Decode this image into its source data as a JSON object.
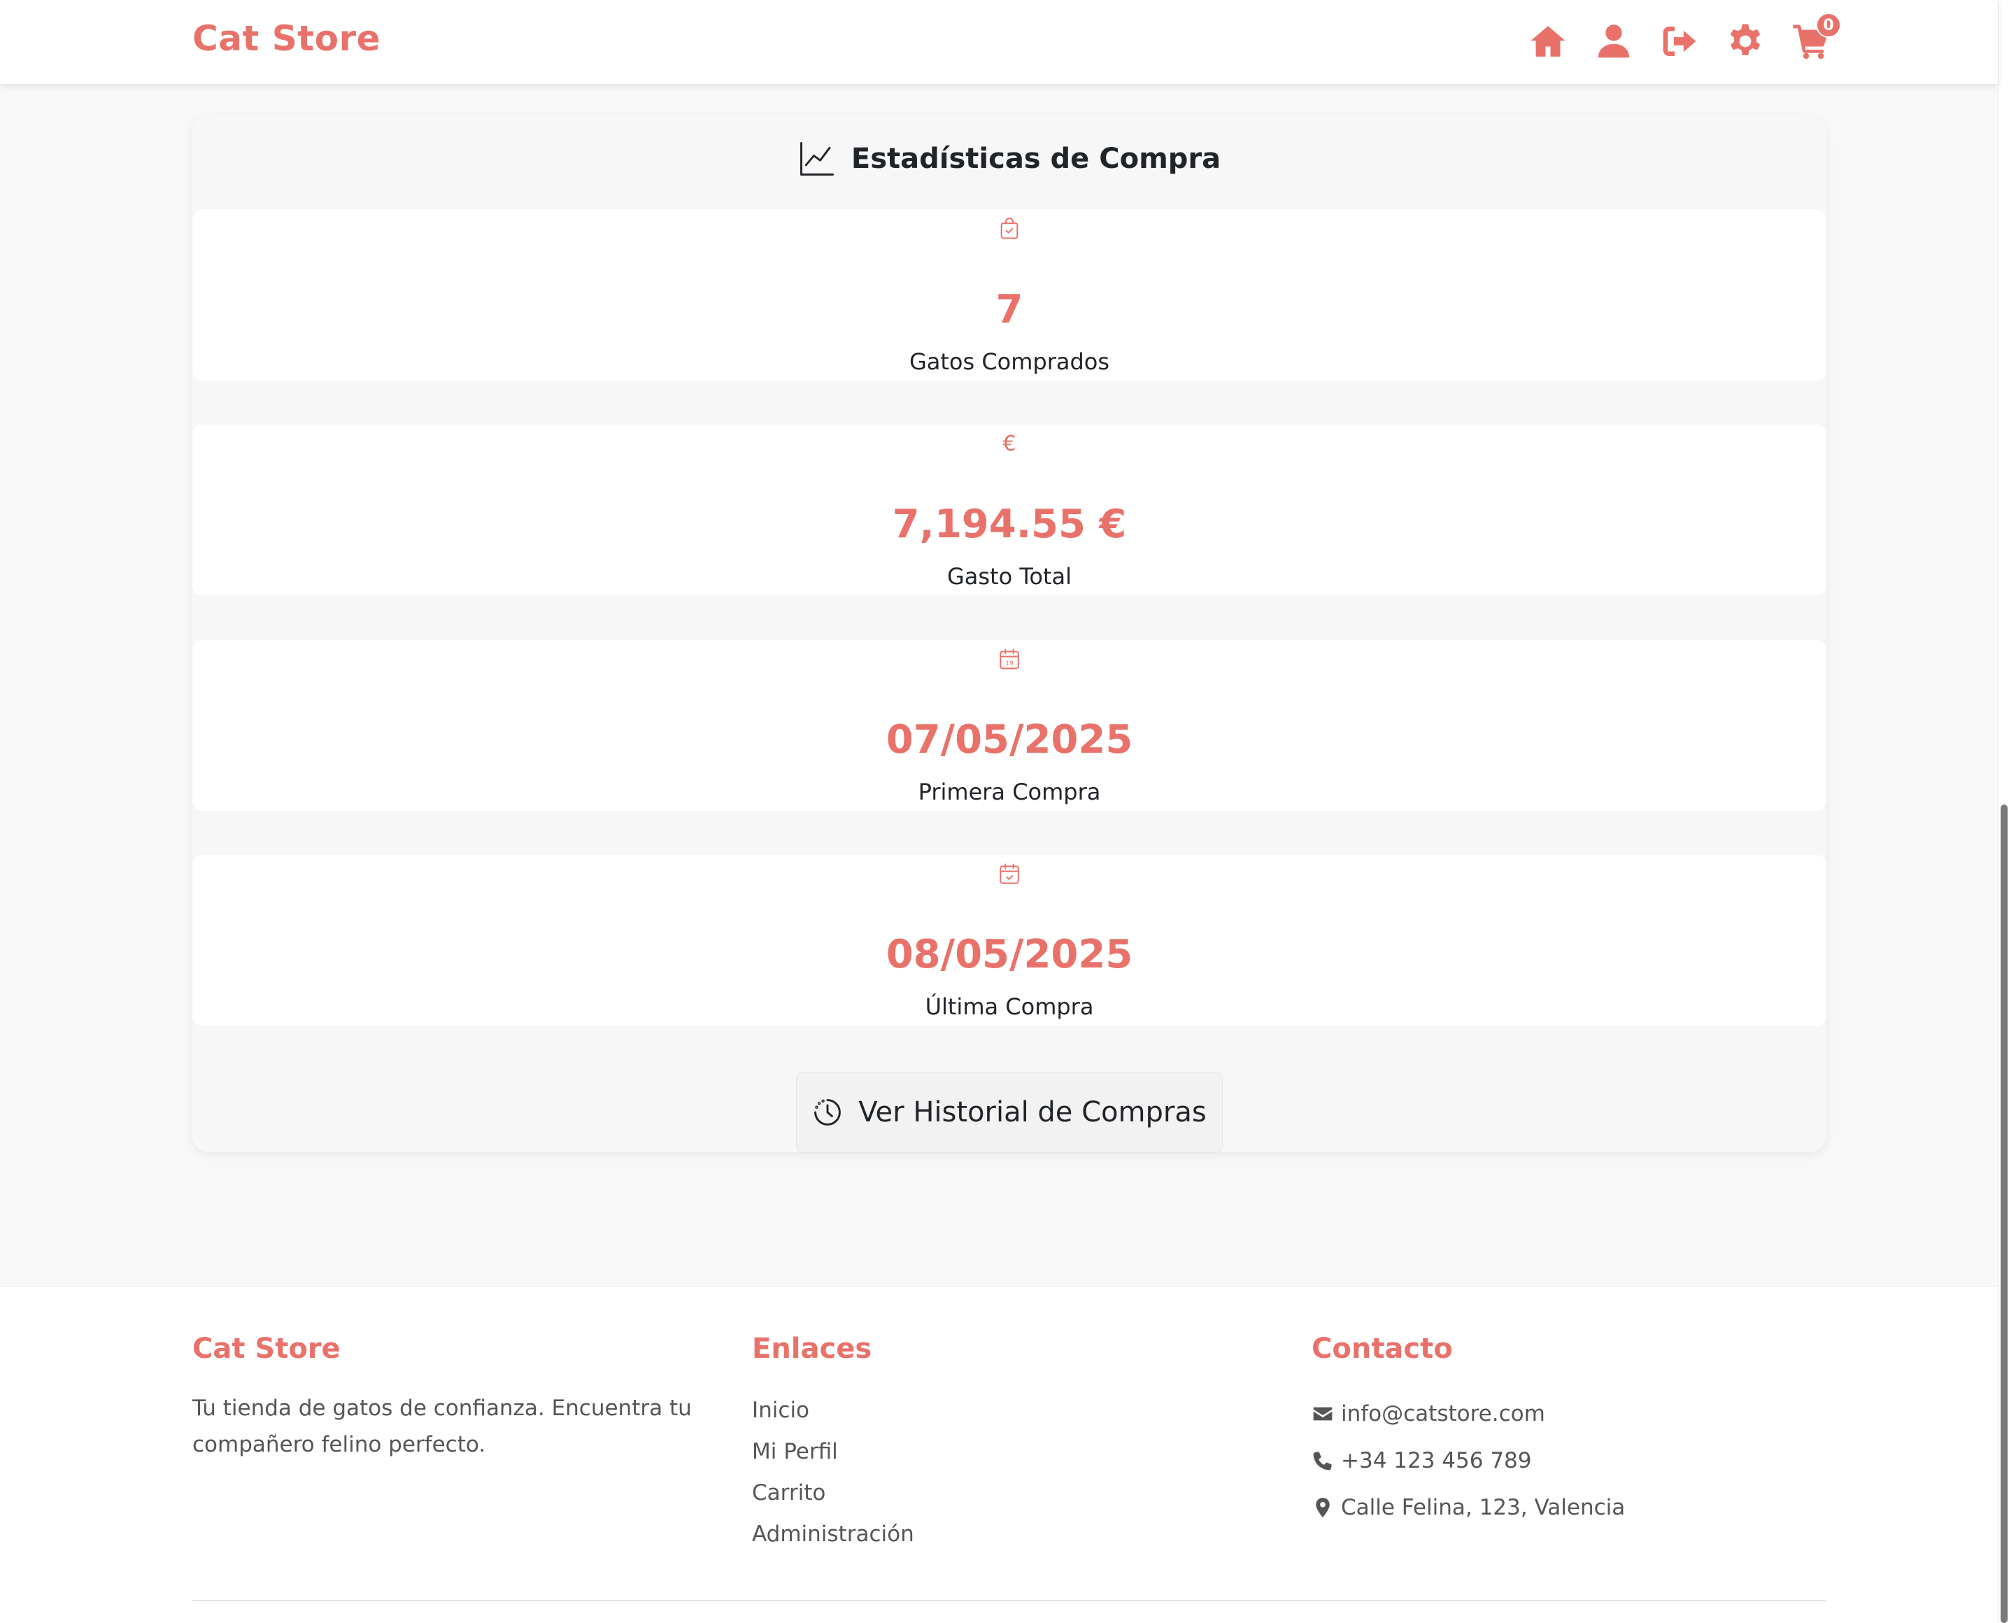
{
  "navbar": {
    "brand": "Cat Store",
    "icons": [
      "home-icon",
      "user-icon",
      "logout-icon",
      "gear-icon",
      "cart-icon"
    ],
    "cart_count": "0"
  },
  "stats": {
    "title": "Estadísticas de Compra",
    "items": [
      {
        "icon": "shopping-bag-icon",
        "value": "7",
        "label": "Gatos Comprados"
      },
      {
        "icon": "euro-icon",
        "value": "7,194.55 €",
        "label": "Gasto Total",
        "icon_glyph": "€"
      },
      {
        "icon": "calendar-icon",
        "value": "07/05/2025",
        "label": "Primera Compra"
      },
      {
        "icon": "calendar-check-icon",
        "value": "08/05/2025",
        "label": "Última Compra"
      }
    ],
    "history_button": "Ver Historial de Compras"
  },
  "footer": {
    "brand": {
      "title": "Cat Store",
      "description": "Tu tienda de gatos de confianza. Encuentra tu compañero felino perfecto."
    },
    "links": {
      "title": "Enlaces",
      "items": [
        "Inicio",
        "Mi Perfil",
        "Carrito",
        "Administración"
      ]
    },
    "contact": {
      "title": "Contacto",
      "email": "info@catstore.com",
      "phone": "+34 123 456 789",
      "address": "Calle Felina, 123, Valencia"
    }
  },
  "colors": {
    "accent": "#e8726a",
    "background": "#f8f8f8",
    "text": "#212529"
  }
}
